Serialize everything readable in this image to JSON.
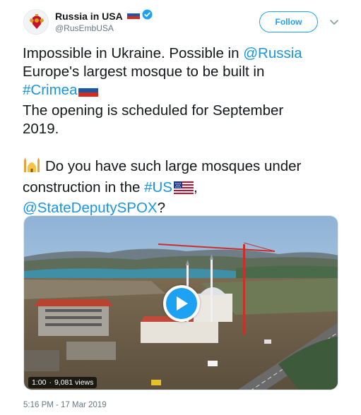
{
  "account": {
    "display_name": "Russia in USA",
    "handle": "@RusEmbUSA",
    "flag_icon": "russia-flag-icon",
    "verified_icon": "verified-badge-icon"
  },
  "follow_label": "Follow",
  "tweet": {
    "line1": "Impossible in Ukraine. Possible in ",
    "mention_russia": "@Russia",
    "line2": "Europe's largest mosque to be built in",
    "hashtag_crimea": "#Crimea",
    "line3": "The opening is scheduled for September",
    "line4": "2019.",
    "line5": "Do you have such large mosques under",
    "line6": "construction in the ",
    "hashtag_us": "#US",
    "line6_after": ",",
    "mention_spox": "@StateDeputySPOX",
    "line7_after": "?"
  },
  "video": {
    "duration": "1:00",
    "separator": "·",
    "views": "9,081 views"
  },
  "timestamp": "5:16 PM - 17 Mar 2019",
  "colors": {
    "link": "#1b95e0",
    "accent": "#1da1f2",
    "muted": "#657786"
  }
}
